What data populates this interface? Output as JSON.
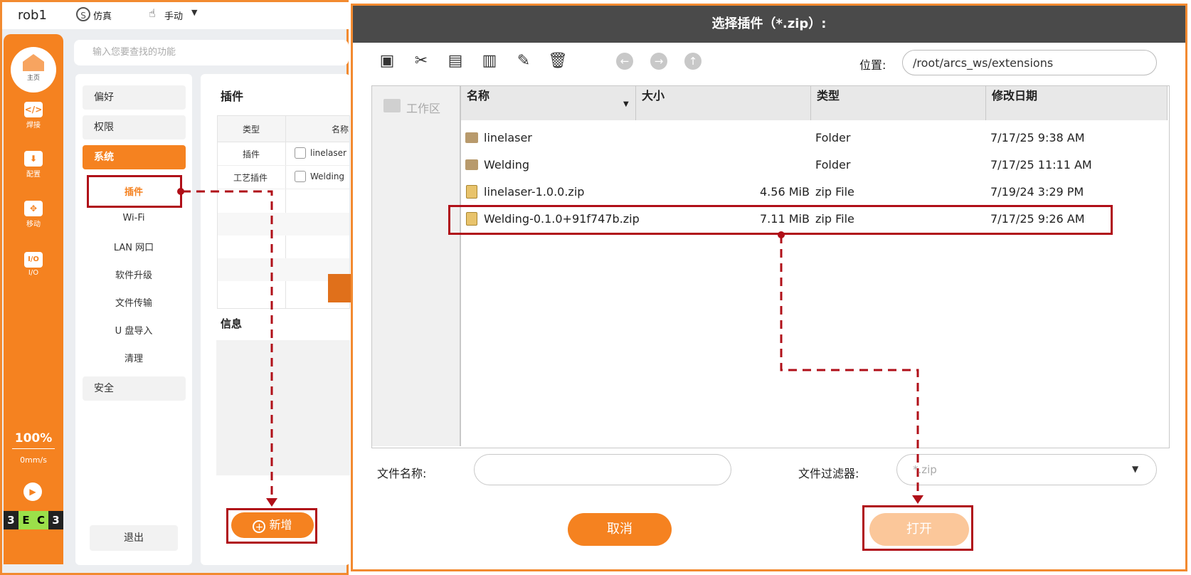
{
  "app": {
    "robot_name": "rob1",
    "sim_label": "仿真",
    "mode_label": "手动",
    "search_placeholder": "输入您要查找的功能",
    "nav": [
      {
        "label": "主页",
        "icon": "home-icon"
      },
      {
        "label": "焊接",
        "icon": "code-icon"
      },
      {
        "label": "配置",
        "icon": "download-icon"
      },
      {
        "label": "移动",
        "icon": "move-icon"
      },
      {
        "label": "I/O",
        "icon": "io-icon"
      }
    ],
    "io_glyph": "I/O",
    "speed_percent": "100%",
    "speed_value": "0mm/s",
    "status_code": [
      "3",
      "E",
      "C",
      "3"
    ],
    "menu": {
      "pref": "偏好",
      "perm": "权限",
      "system": "系统",
      "security": "安全",
      "sub": [
        "插件",
        "Wi-Fi",
        "LAN 网口",
        "软件升级",
        "文件传输",
        "U 盘导入",
        "清理"
      ],
      "logout": "退出"
    },
    "plugin_section": {
      "title": "插件",
      "col_type": "类型",
      "col_name": "名称",
      "rows": [
        {
          "type": "插件",
          "name": "linelaser"
        },
        {
          "type": "工艺插件",
          "name": "Welding"
        }
      ],
      "info_title": "信息",
      "add_button": "新增"
    }
  },
  "dialog": {
    "title": "选择插件（*.zip）:",
    "location_label": "位置:",
    "location_value": "/root/arcs_ws/extensions",
    "places": [
      "工作区"
    ],
    "columns": [
      "名称",
      "大小",
      "类型",
      "修改日期"
    ],
    "files": [
      {
        "name": "linelaser",
        "size": "",
        "type": "Folder",
        "modified": "7/17/25 9:38 AM",
        "kind": "folder"
      },
      {
        "name": "Welding",
        "size": "",
        "type": "Folder",
        "modified": "7/17/25 11:11 AM",
        "kind": "folder"
      },
      {
        "name": "linelaser-1.0.0.zip",
        "size": "4.56 MiB",
        "type": "zip File",
        "modified": "7/19/24 3:29 PM",
        "kind": "zip"
      },
      {
        "name": "Welding-0.1.0+91f747b.zip",
        "size": "7.11 MiB",
        "type": "zip File",
        "modified": "7/17/25 9:26 AM",
        "kind": "zip"
      }
    ],
    "filename_label": "文件名称:",
    "filename_value": "",
    "filter_label": "文件过滤器:",
    "filter_value": "*.zip",
    "cancel_label": "取消",
    "open_label": "打开"
  },
  "colors": {
    "accent": "#f58220",
    "annotation": "#b00f18",
    "title_bar": "#4a4a4a"
  }
}
